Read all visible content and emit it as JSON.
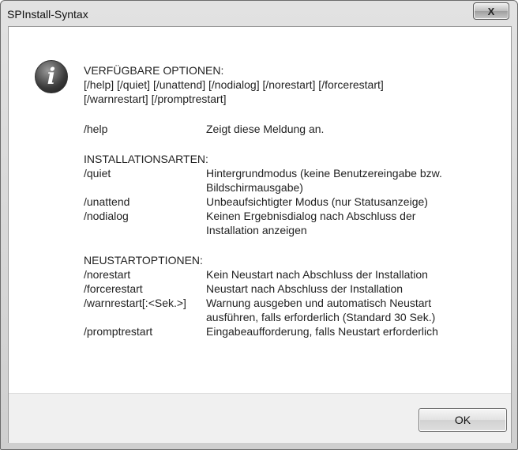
{
  "window": {
    "title": "SPInstall-Syntax",
    "close_label": "X"
  },
  "message": {
    "icon": "info-icon",
    "header": "VERFÜGBARE OPTIONEN:",
    "syntax_line1": "[/help] [/quiet] [/unattend] [/nodialog] [/norestart] [/forcerestart]",
    "syntax_line2": "[/warnrestart] [/promptrestart]",
    "help": {
      "option": "/help",
      "description": [
        "Zeigt diese Meldung an."
      ]
    },
    "install_section": {
      "heading": "INSTALLATIONSARTEN:",
      "items": [
        {
          "option": "/quiet",
          "description": [
            "Hintergrundmodus (keine Benutzereingabe bzw.",
            "Bildschirmausgabe)"
          ]
        },
        {
          "option": "/unattend",
          "description": [
            "Unbeaufsichtigter Modus (nur Statusanzeige)"
          ]
        },
        {
          "option": "/nodialog",
          "description": [
            "Keinen Ergebnisdialog nach Abschluss der",
            "Installation anzeigen"
          ]
        }
      ]
    },
    "restart_section": {
      "heading": "NEUSTARTOPTIONEN:",
      "items": [
        {
          "option": "/norestart",
          "description": [
            "Kein Neustart nach Abschluss der Installation"
          ]
        },
        {
          "option": "/forcerestart",
          "description": [
            "Neustart nach Abschluss der Installation"
          ]
        },
        {
          "option": "/warnrestart[:<Sek.>]",
          "description": [
            "Warnung ausgeben und automatisch Neustart",
            "ausführen, falls erforderlich (Standard 30 Sek.)"
          ]
        },
        {
          "option": "/promptrestart",
          "description": [
            "Eingabeaufforderung, falls Neustart erforderlich"
          ]
        }
      ]
    }
  },
  "buttons": {
    "ok_label": "OK"
  }
}
